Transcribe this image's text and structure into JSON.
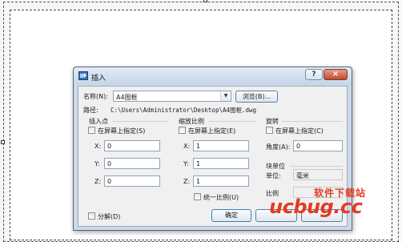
{
  "dialog": {
    "title": "插入",
    "help_label": "?",
    "close_label": "×",
    "name_label": "名称(N):",
    "name_value": "A4图框",
    "browse_label": "浏览(B)...",
    "path_label": "路径:",
    "path_value": "C:\\Users\\Administrator\\Desktop\\A4图框.dwg",
    "insertion": {
      "title": "插入点",
      "onscreen_label": "在屏幕上指定(S)",
      "x_label": "X:",
      "x_value": "0",
      "y_label": "Y:",
      "y_value": "0",
      "z_label": "Z:",
      "z_value": "0"
    },
    "scale": {
      "title": "缩放比例",
      "onscreen_label": "在屏幕上指定(E)",
      "x_label": "X:",
      "x_value": "1",
      "y_label": "Y:",
      "y_value": "1",
      "z_label": "Z:",
      "z_value": "1",
      "uniform_label": "统一比例(U)"
    },
    "rotation": {
      "title": "旋转",
      "onscreen_label": "在屏幕上指定(C)",
      "angle_label": "角度(A):",
      "angle_value": "0"
    },
    "block_unit": {
      "title": "块单位",
      "unit_label": "单位:",
      "unit_value": "毫米",
      "scale_label": "比例"
    },
    "explode_label": "分解(D)",
    "ok_label": "确定"
  },
  "watermark": {
    "cn": "软件下载站",
    "en": "ucbug.cc"
  },
  "colors": {
    "accent": "#e33b20",
    "dialog_frame": "#ccd9e8"
  }
}
